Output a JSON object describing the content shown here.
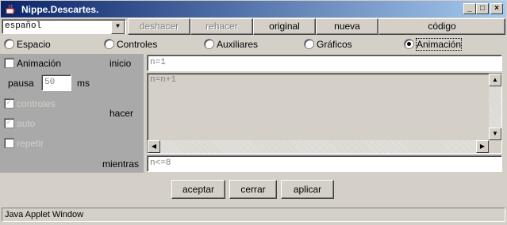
{
  "window": {
    "title": "Nippe.Descartes.",
    "minimize_glyph": "_",
    "maximize_glyph": "□",
    "close_glyph": "×"
  },
  "toolbar": {
    "language": "español",
    "combo_arrow": "▼",
    "buttons": [
      "deshacer",
      "rehacer",
      "original",
      "nueva",
      "código"
    ]
  },
  "tabs": {
    "items": [
      "Espacio",
      "Controles",
      "Auxiliares",
      "Gráficos",
      "Animación"
    ],
    "selected": "Animación"
  },
  "animation": {
    "animacion_label": "Animación",
    "pausa_label": "pausa",
    "pausa_value": "50",
    "ms_label": "ms",
    "controles_label": "controles",
    "auto_label": "auto",
    "repetir_label": "repetir",
    "check_mark": "✓",
    "inicio_label": "inicio",
    "inicio_value": "n=1",
    "hacer_label": "hacer",
    "hacer_value": "n=n+1",
    "mientras_label": "mientras",
    "mientras_value": "n<=8",
    "scroll_up": "▲",
    "scroll_down": "▼",
    "scroll_left": "◀",
    "scroll_right": "▶"
  },
  "actions": {
    "aceptar": "aceptar",
    "cerrar": "cerrar",
    "aplicar": "aplicar"
  },
  "status": {
    "text": "Java Applet Window"
  },
  "colors": {
    "title_gradient_start": "#0a246a",
    "title_gradient_end": "#a6caf0",
    "panel_gray": "#a9a9a9",
    "face": "#d4d0c8"
  }
}
